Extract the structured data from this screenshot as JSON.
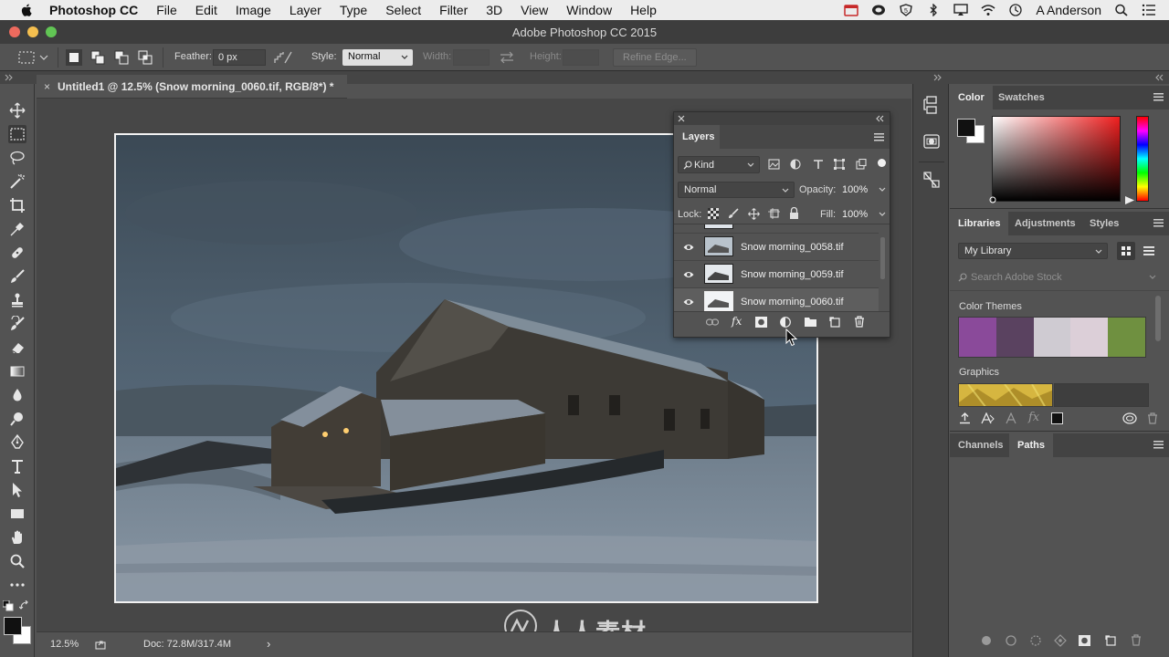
{
  "menubar": {
    "app_name": "Photoshop CC",
    "items": [
      "File",
      "Edit",
      "Image",
      "Layer",
      "Type",
      "Select",
      "Filter",
      "3D",
      "View",
      "Window",
      "Help"
    ],
    "user": "A Anderson"
  },
  "window": {
    "title": "Adobe Photoshop CC 2015"
  },
  "options": {
    "feather_label": "Feather:",
    "feather_value": "0 px",
    "style_label": "Style:",
    "style_value": "Normal",
    "width_label": "Width:",
    "height_label": "Height:",
    "refine_edge_label": "Refine Edge..."
  },
  "document": {
    "tab_title": "Untitled1 @ 12.5% (Snow morning_0060.tif, RGB/8*) *",
    "close_glyph": "×"
  },
  "status": {
    "zoom": "12.5%",
    "doc_size": "Doc: 72.8M/317.4M",
    "arrow": "›"
  },
  "layers_panel": {
    "tab_label": "Layers",
    "filter_label": "Kind",
    "blend_mode": "Normal",
    "opacity_label": "Opacity:",
    "opacity_value": "100%",
    "lock_label": "Lock:",
    "fill_label": "Fill:",
    "fill_value": "100%",
    "layers": [
      {
        "name": "Snow morning_0058.tif",
        "visible": true
      },
      {
        "name": "Snow morning_0059.tif",
        "visible": true
      },
      {
        "name": "Snow morning_0060.tif",
        "visible": true
      }
    ]
  },
  "color_panel": {
    "tabs": [
      "Color",
      "Swatches"
    ],
    "active_tab": "Color"
  },
  "libraries_panel": {
    "tabs": [
      "Libraries",
      "Adjustments",
      "Styles"
    ],
    "active_tab": "Libraries",
    "library_select": "My Library",
    "search_placeholder": "Search Adobe Stock",
    "color_themes_label": "Color Themes",
    "color_theme_swatches": [
      "#8a4a9a",
      "#5a4260",
      "#cfcbd2",
      "#dccfd8",
      "#6f9040"
    ],
    "graphics_label": "Graphics"
  },
  "channels_panel": {
    "tabs": [
      "Channels",
      "Paths"
    ],
    "active_tab": "Paths"
  },
  "watermark": {
    "text": "人人素材"
  },
  "colors": {
    "foreground": "#111111",
    "background": "#ffffff"
  }
}
